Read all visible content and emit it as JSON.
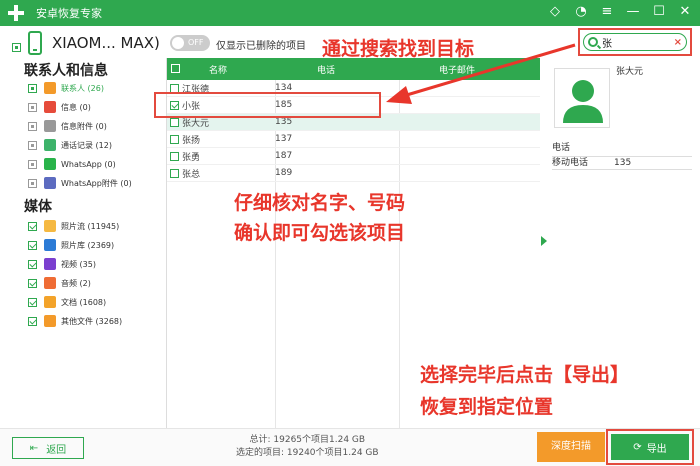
{
  "app": {
    "title": "安卓恢复专家",
    "win_icons": [
      "diamond-icon",
      "chat-icon",
      "menu-icon",
      "minimize-icon",
      "maximize-icon",
      "close-icon"
    ]
  },
  "device": {
    "name": "XIAOM... MAX)",
    "toggle_label": "OFF",
    "filter_label": "仅显示已删除的项目"
  },
  "search": {
    "value": "张",
    "clear": "×"
  },
  "annotations": {
    "search_hint": "通过搜索找到目标",
    "verify_line1": "仔细核对名字、号码",
    "verify_line2": "确认即可勾选该项目",
    "export_line1": "选择完毕后点击【导出】",
    "export_line2": "恢复到指定位置"
  },
  "sidebar": {
    "contacts_heading": "联系人和信息",
    "contacts_items": [
      {
        "label": "联系人 (26)",
        "icon": "contacts-icon",
        "color": "#f39a2a",
        "check": "part",
        "active": true
      },
      {
        "label": "信息 (0)",
        "icon": "message-icon",
        "color": "#e64b3b",
        "check": "gray"
      },
      {
        "label": "信息附件 (0)",
        "icon": "attachment-icon",
        "color": "#999999",
        "check": "gray"
      },
      {
        "label": "通话记录 (12)",
        "icon": "phone-icon",
        "color": "#3db36a",
        "check": "gray"
      },
      {
        "label": "WhatsApp (0)",
        "icon": "whatsapp-icon",
        "color": "#29b34a",
        "check": "gray"
      },
      {
        "label": "WhatsApp附件 (0)",
        "icon": "whatsapp-attachment-icon",
        "color": "#5c6bc0",
        "check": "gray"
      }
    ],
    "media_heading": "媒体",
    "media_items": [
      {
        "label": "照片流 (11945)",
        "icon": "photostream-icon",
        "color": "#f5b942",
        "check": "on"
      },
      {
        "label": "照片库 (2369)",
        "icon": "gallery-icon",
        "color": "#2c7bd6",
        "check": "on"
      },
      {
        "label": "视频 (35)",
        "icon": "video-icon",
        "color": "#7b3fcf",
        "check": "on"
      },
      {
        "label": "音频 (2)",
        "icon": "audio-icon",
        "color": "#ef6c35",
        "check": "on"
      },
      {
        "label": "文档 (1608)",
        "icon": "document-icon",
        "color": "#f3a32a",
        "check": "on"
      },
      {
        "label": "其他文件 (3268)",
        "icon": "other-files-icon",
        "color": "#f39a2a",
        "check": "on"
      }
    ]
  },
  "table": {
    "headers": {
      "name": "名称",
      "phone": "电话",
      "email": "电子邮件"
    },
    "rows": [
      {
        "name": "江张德",
        "phone": "134",
        "check": false
      },
      {
        "name": "小张",
        "phone": "185",
        "check": true
      },
      {
        "name": "张大元",
        "phone": "135",
        "check": false,
        "selected": true
      },
      {
        "name": "张扬",
        "phone": "137",
        "check": false
      },
      {
        "name": "张勇",
        "phone": "187",
        "check": false
      },
      {
        "name": "张总",
        "phone": "189",
        "check": false
      }
    ]
  },
  "detail": {
    "name": "张大元",
    "section": "电话",
    "field_label": "移动电话",
    "field_value": "135",
    "avatar_color": "#2fa84f"
  },
  "footer": {
    "back_label": "返回",
    "total": "总计: 19265个项目1.24 GB",
    "selected": "选定的项目: 19240个项目1.24 GB",
    "deep_scan": "深度扫描",
    "export": "导出"
  },
  "colors": {
    "brand": "#2fa84f",
    "annotation": "#e8362b",
    "highlight": "#e34a3e"
  }
}
